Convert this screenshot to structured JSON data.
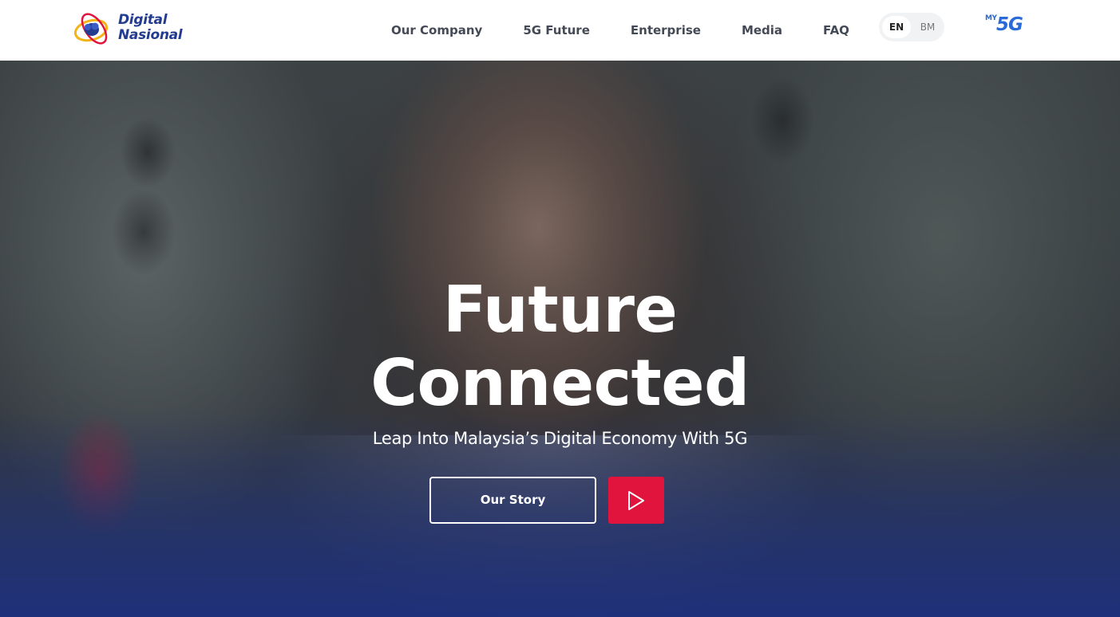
{
  "brand": {
    "line1": "Digital",
    "line2": "Nasional",
    "colors": {
      "blue": "#243c8f",
      "yellow": "#f2b417",
      "red": "#e0143c"
    }
  },
  "nav": {
    "items": [
      {
        "label": "Our Company"
      },
      {
        "label": "5G Future"
      },
      {
        "label": "Enterprise"
      },
      {
        "label": "Media"
      },
      {
        "label": "FAQ"
      }
    ]
  },
  "language": {
    "options": [
      "EN",
      "BM"
    ],
    "selected": "EN"
  },
  "my5g": {
    "small": "MY",
    "big": "5G",
    "color": "#2a6ad8"
  },
  "hero": {
    "title_line1": "Future",
    "title_line2": "Connected",
    "subtitle": "Leap Into Malaysia’s Digital Economy With 5G",
    "cta_label": "Our Story",
    "play_icon": "play-icon",
    "play_color": "#e0143c"
  }
}
